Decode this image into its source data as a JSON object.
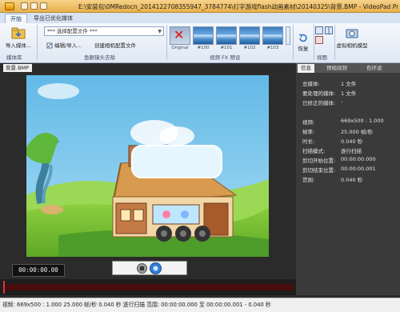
{
  "window": {
    "title": "E:\\安装包\\0MRedocn_2014122708355947_3784774\\打字游戏flash动画素材\\20140325\\背景.BMP - VideoPad ProDren..."
  },
  "tabs": [
    "开始",
    "导出已优化媒体"
  ],
  "ribbon": {
    "import_label": "导入媒体...",
    "import_group": "媒体库",
    "profile_value": "*** 选择配置文件 ***",
    "edit_import": "编辑/导入...",
    "create_profile": "创建相机配置文件",
    "lens_group": "鱼眼镜头去除",
    "effect_thumbs": [
      "Original",
      "#100",
      "#101",
      "#102",
      "#103"
    ],
    "effect_group": "视频 FX 预设",
    "restore_label": "恢复",
    "preview_group": "视图",
    "camera_label": "虚拟相机模型"
  },
  "preview": {
    "tab_label": "背景.BMP"
  },
  "info_panel": {
    "tabs": [
      "信息",
      "预缩视频",
      "色环滤"
    ],
    "rows": [
      {
        "label": "总媒体:",
        "value": "1 文件"
      },
      {
        "label": "要处理的媒体:",
        "value": "1 文件"
      },
      {
        "label": "已修正的媒体:",
        "value": "-"
      },
      {
        "label": "",
        "value": ""
      },
      {
        "label": "视频:",
        "value": "669x500 : 1.000"
      },
      {
        "label": "帧率:",
        "value": "25.000 帧/秒"
      },
      {
        "label": "时长:",
        "value": "0.040 秒"
      },
      {
        "label": "扫描模式:",
        "value": "逐行扫描"
      },
      {
        "label": "剪切开始位置:",
        "value": "00:00:00.000"
      },
      {
        "label": "剪切结束位置:",
        "value": "00:00:00.001"
      },
      {
        "label": "范围:",
        "value": "0.040 秒"
      }
    ]
  },
  "timeline": {
    "timecode": "00:00:00.00"
  },
  "statusbar": {
    "text": "视频: 669x500 : 1.000   25.000 帧/秒   0.040 秒   逐行扫描   范围: 00:00:00.000 至 00:00:00.001 - 0.040 秒"
  },
  "colors": {
    "ribbon_accent": "#e9b04a",
    "panel_bg": "#3a3a3a",
    "track_red": "#4a0d0d"
  }
}
